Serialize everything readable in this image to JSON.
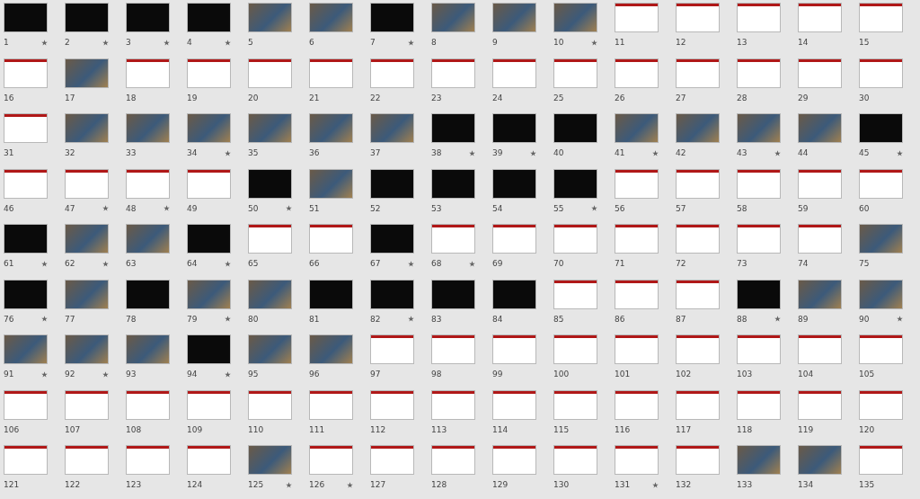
{
  "slides": [
    {
      "number": "1",
      "kind": "dark",
      "animated": true
    },
    {
      "number": "2",
      "kind": "dark",
      "animated": true
    },
    {
      "number": "3",
      "kind": "dark",
      "animated": true
    },
    {
      "number": "4",
      "kind": "dark",
      "animated": true
    },
    {
      "number": "5",
      "kind": "photo",
      "animated": false
    },
    {
      "number": "6",
      "kind": "photo",
      "animated": false
    },
    {
      "number": "7",
      "kind": "dark",
      "animated": true
    },
    {
      "number": "8",
      "kind": "photo",
      "animated": false
    },
    {
      "number": "9",
      "kind": "photo",
      "animated": false
    },
    {
      "number": "10",
      "kind": "photo",
      "animated": true
    },
    {
      "number": "11",
      "kind": "light",
      "animated": false
    },
    {
      "number": "12",
      "kind": "light",
      "animated": false
    },
    {
      "number": "13",
      "kind": "light",
      "animated": false
    },
    {
      "number": "14",
      "kind": "light",
      "animated": false
    },
    {
      "number": "15",
      "kind": "light",
      "animated": false
    },
    {
      "number": "16",
      "kind": "light",
      "animated": false
    },
    {
      "number": "17",
      "kind": "photo",
      "animated": false
    },
    {
      "number": "18",
      "kind": "light",
      "animated": false
    },
    {
      "number": "19",
      "kind": "light",
      "animated": false
    },
    {
      "number": "20",
      "kind": "light",
      "animated": false
    },
    {
      "number": "21",
      "kind": "light",
      "animated": false
    },
    {
      "number": "22",
      "kind": "light",
      "animated": false
    },
    {
      "number": "23",
      "kind": "light",
      "animated": false
    },
    {
      "number": "24",
      "kind": "light",
      "animated": false
    },
    {
      "number": "25",
      "kind": "light",
      "animated": false
    },
    {
      "number": "26",
      "kind": "light",
      "animated": false
    },
    {
      "number": "27",
      "kind": "light",
      "animated": false
    },
    {
      "number": "28",
      "kind": "light",
      "animated": false
    },
    {
      "number": "29",
      "kind": "light",
      "animated": false
    },
    {
      "number": "30",
      "kind": "light",
      "animated": false
    },
    {
      "number": "31",
      "kind": "light",
      "animated": false
    },
    {
      "number": "32",
      "kind": "photo",
      "animated": false
    },
    {
      "number": "33",
      "kind": "photo",
      "animated": false
    },
    {
      "number": "34",
      "kind": "photo",
      "animated": true
    },
    {
      "number": "35",
      "kind": "photo",
      "animated": false
    },
    {
      "number": "36",
      "kind": "photo",
      "animated": false
    },
    {
      "number": "37",
      "kind": "photo",
      "animated": false
    },
    {
      "number": "38",
      "kind": "dark",
      "animated": true
    },
    {
      "number": "39",
      "kind": "dark",
      "animated": true
    },
    {
      "number": "40",
      "kind": "dark",
      "animated": false
    },
    {
      "number": "41",
      "kind": "photo",
      "animated": true
    },
    {
      "number": "42",
      "kind": "photo",
      "animated": false
    },
    {
      "number": "43",
      "kind": "photo",
      "animated": true
    },
    {
      "number": "44",
      "kind": "photo",
      "animated": false
    },
    {
      "number": "45",
      "kind": "dark",
      "animated": true
    },
    {
      "number": "46",
      "kind": "light",
      "animated": false
    },
    {
      "number": "47",
      "kind": "light",
      "animated": true
    },
    {
      "number": "48",
      "kind": "light",
      "animated": true
    },
    {
      "number": "49",
      "kind": "light",
      "animated": false
    },
    {
      "number": "50",
      "kind": "dark",
      "animated": true
    },
    {
      "number": "51",
      "kind": "photo",
      "animated": false
    },
    {
      "number": "52",
      "kind": "dark",
      "animated": false
    },
    {
      "number": "53",
      "kind": "dark",
      "animated": false
    },
    {
      "number": "54",
      "kind": "dark",
      "animated": false
    },
    {
      "number": "55",
      "kind": "dark",
      "animated": true
    },
    {
      "number": "56",
      "kind": "light",
      "animated": false
    },
    {
      "number": "57",
      "kind": "light",
      "animated": false
    },
    {
      "number": "58",
      "kind": "light",
      "animated": false
    },
    {
      "number": "59",
      "kind": "light",
      "animated": false
    },
    {
      "number": "60",
      "kind": "light",
      "animated": false
    },
    {
      "number": "61",
      "kind": "dark",
      "animated": true
    },
    {
      "number": "62",
      "kind": "photo",
      "animated": true
    },
    {
      "number": "63",
      "kind": "photo",
      "animated": false
    },
    {
      "number": "64",
      "kind": "dark",
      "animated": true
    },
    {
      "number": "65",
      "kind": "light",
      "animated": false
    },
    {
      "number": "66",
      "kind": "light",
      "animated": false
    },
    {
      "number": "67",
      "kind": "dark",
      "animated": true
    },
    {
      "number": "68",
      "kind": "light",
      "animated": true
    },
    {
      "number": "69",
      "kind": "light",
      "animated": false
    },
    {
      "number": "70",
      "kind": "light",
      "animated": false
    },
    {
      "number": "71",
      "kind": "light",
      "animated": false
    },
    {
      "number": "72",
      "kind": "light",
      "animated": false
    },
    {
      "number": "73",
      "kind": "light",
      "animated": false
    },
    {
      "number": "74",
      "kind": "light",
      "animated": false
    },
    {
      "number": "75",
      "kind": "photo",
      "animated": false
    },
    {
      "number": "76",
      "kind": "dark",
      "animated": true
    },
    {
      "number": "77",
      "kind": "photo",
      "animated": false
    },
    {
      "number": "78",
      "kind": "dark",
      "animated": false
    },
    {
      "number": "79",
      "kind": "photo",
      "animated": true
    },
    {
      "number": "80",
      "kind": "photo",
      "animated": false
    },
    {
      "number": "81",
      "kind": "dark",
      "animated": false
    },
    {
      "number": "82",
      "kind": "dark",
      "animated": true
    },
    {
      "number": "83",
      "kind": "dark",
      "animated": false
    },
    {
      "number": "84",
      "kind": "dark",
      "animated": false
    },
    {
      "number": "85",
      "kind": "light",
      "animated": false
    },
    {
      "number": "86",
      "kind": "light",
      "animated": false
    },
    {
      "number": "87",
      "kind": "light",
      "animated": false
    },
    {
      "number": "88",
      "kind": "dark",
      "animated": true
    },
    {
      "number": "89",
      "kind": "photo",
      "animated": false
    },
    {
      "number": "90",
      "kind": "photo",
      "animated": true
    },
    {
      "number": "91",
      "kind": "photo",
      "animated": true
    },
    {
      "number": "92",
      "kind": "photo",
      "animated": true
    },
    {
      "number": "93",
      "kind": "photo",
      "animated": false
    },
    {
      "number": "94",
      "kind": "dark",
      "animated": true
    },
    {
      "number": "95",
      "kind": "photo",
      "animated": false
    },
    {
      "number": "96",
      "kind": "photo",
      "animated": false
    },
    {
      "number": "97",
      "kind": "light",
      "animated": false
    },
    {
      "number": "98",
      "kind": "light",
      "animated": false
    },
    {
      "number": "99",
      "kind": "light",
      "animated": false
    },
    {
      "number": "100",
      "kind": "light",
      "animated": false
    },
    {
      "number": "101",
      "kind": "light",
      "animated": false
    },
    {
      "number": "102",
      "kind": "light",
      "animated": false
    },
    {
      "number": "103",
      "kind": "light",
      "animated": false
    },
    {
      "number": "104",
      "kind": "light",
      "animated": false
    },
    {
      "number": "105",
      "kind": "light",
      "animated": false
    },
    {
      "number": "106",
      "kind": "light",
      "animated": false
    },
    {
      "number": "107",
      "kind": "light",
      "animated": false
    },
    {
      "number": "108",
      "kind": "light",
      "animated": false
    },
    {
      "number": "109",
      "kind": "light",
      "animated": false
    },
    {
      "number": "110",
      "kind": "light",
      "animated": false
    },
    {
      "number": "111",
      "kind": "light",
      "animated": false
    },
    {
      "number": "112",
      "kind": "light",
      "animated": false
    },
    {
      "number": "113",
      "kind": "light",
      "animated": false
    },
    {
      "number": "114",
      "kind": "light",
      "animated": false
    },
    {
      "number": "115",
      "kind": "light",
      "animated": false
    },
    {
      "number": "116",
      "kind": "light",
      "animated": false
    },
    {
      "number": "117",
      "kind": "light",
      "animated": false
    },
    {
      "number": "118",
      "kind": "light",
      "animated": false
    },
    {
      "number": "119",
      "kind": "light",
      "animated": false
    },
    {
      "number": "120",
      "kind": "light",
      "animated": false
    },
    {
      "number": "121",
      "kind": "light",
      "animated": false
    },
    {
      "number": "122",
      "kind": "light",
      "animated": false
    },
    {
      "number": "123",
      "kind": "light",
      "animated": false
    },
    {
      "number": "124",
      "kind": "light",
      "animated": false
    },
    {
      "number": "125",
      "kind": "photo",
      "animated": true
    },
    {
      "number": "126",
      "kind": "light",
      "animated": true
    },
    {
      "number": "127",
      "kind": "light",
      "animated": false
    },
    {
      "number": "128",
      "kind": "light",
      "animated": false
    },
    {
      "number": "129",
      "kind": "light",
      "animated": false
    },
    {
      "number": "130",
      "kind": "light",
      "animated": false
    },
    {
      "number": "131",
      "kind": "light",
      "animated": true
    },
    {
      "number": "132",
      "kind": "light",
      "animated": false
    },
    {
      "number": "133",
      "kind": "photo",
      "animated": false
    },
    {
      "number": "134",
      "kind": "photo",
      "animated": false
    },
    {
      "number": "135",
      "kind": "light",
      "animated": false
    }
  ]
}
